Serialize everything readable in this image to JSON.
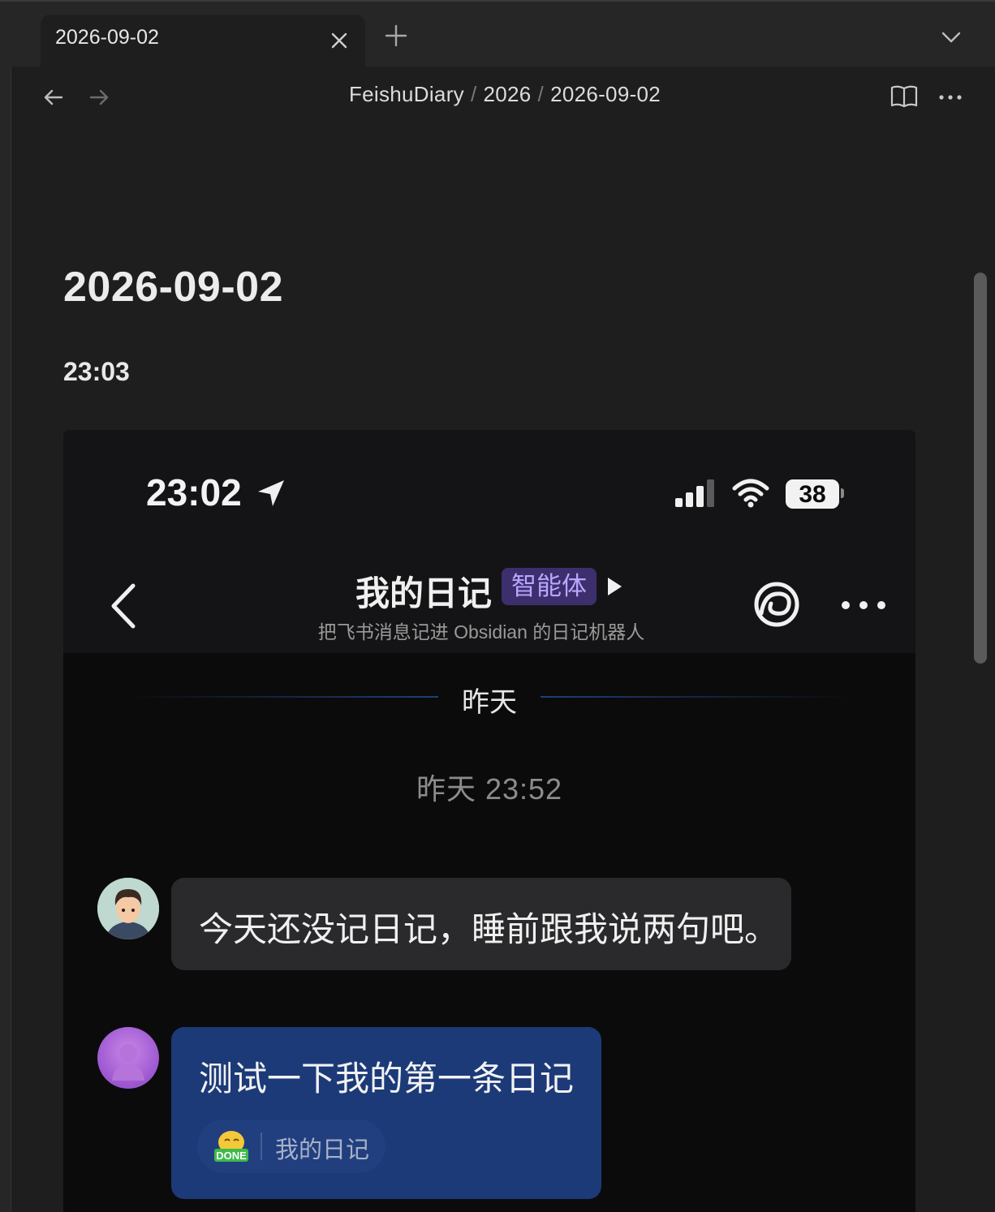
{
  "tabs": [
    {
      "title": "2026-09-02",
      "active": true
    }
  ],
  "breadcrumb": {
    "items": [
      "FeishuDiary",
      "2026",
      "2026-09-02"
    ],
    "separator": "/"
  },
  "note": {
    "title": "2026-09-02",
    "time_heading": "23:03"
  },
  "screenshot": {
    "status_bar": {
      "time": "23:02",
      "battery": "38"
    },
    "chat": {
      "title": "我的日记",
      "badge": "智能体",
      "subtitle": "把飞书消息记进 Obsidian 的日记机器人",
      "date_divider": "昨天",
      "timestamp": "昨天 23:52",
      "messages": [
        {
          "text": "今天还没记日记，睡前跟我说两句吧。"
        },
        {
          "text": "测试一下我的第一条日记",
          "tag_label": "我的日记",
          "tag_icon": "DONE"
        }
      ]
    }
  },
  "colors": {
    "app_bg": "#1e1e1e",
    "tabbar_bg": "#262626",
    "badge_bg": "#3d2f6e",
    "user_bubble": "#1c3a78",
    "bot_bubble": "#2a2a2c"
  }
}
